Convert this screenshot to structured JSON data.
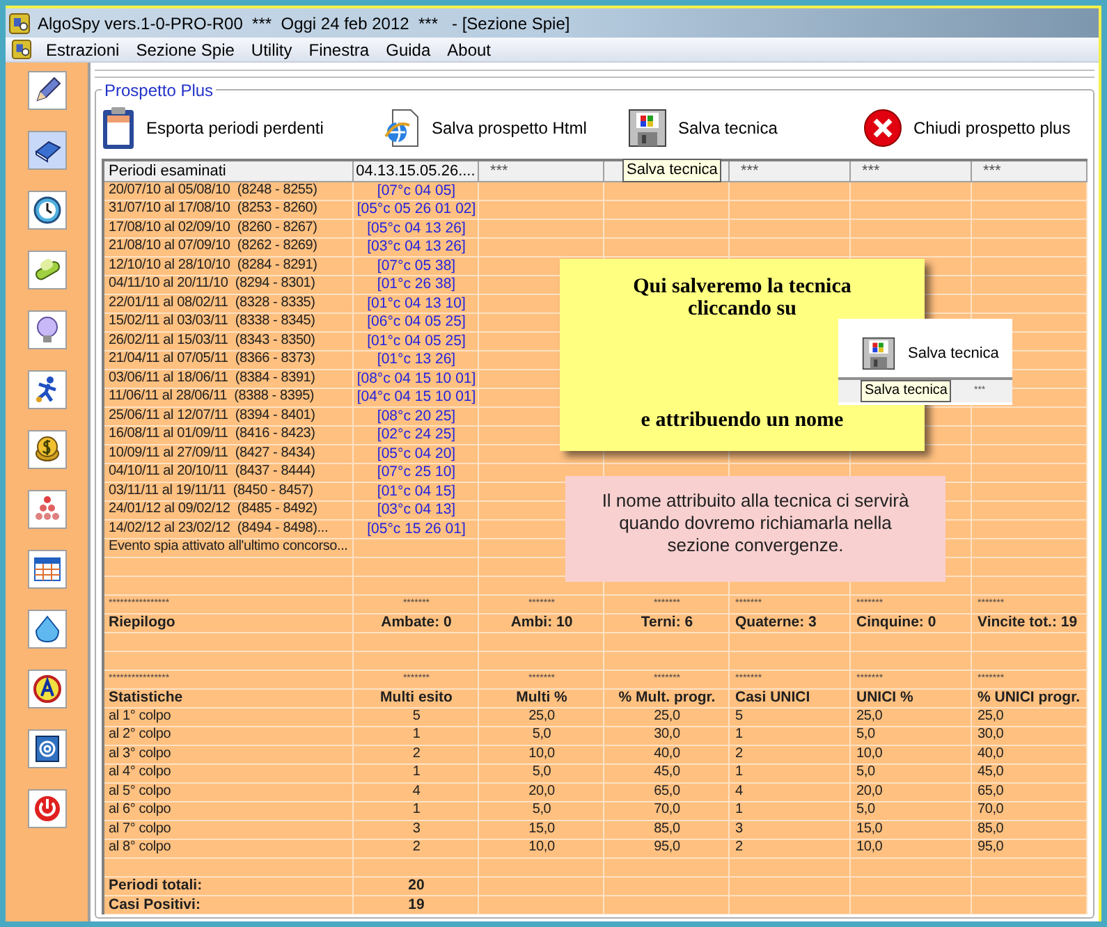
{
  "window": {
    "title": "AlgoSpy vers.1-0-PRO-R00  ***  Oggi 24 feb 2012  ***   - [Sezione Spie]"
  },
  "menu": [
    "Estrazioni",
    "Sezione Spie",
    "Utility",
    "Finestra",
    "Guida",
    "About"
  ],
  "panel": {
    "title": "Prospetto Plus"
  },
  "toolbar": [
    {
      "kind": "export",
      "label": "Esporta periodi perdenti"
    },
    {
      "kind": "html",
      "label": "Salva prospetto Html"
    },
    {
      "kind": "save",
      "label": "Salva tecnica"
    },
    {
      "kind": "close",
      "label": "Chiudi prospetto plus"
    }
  ],
  "tooltip": "Salva tecnica",
  "table": {
    "columns": [
      "Periodi esaminati",
      "04.13.15.05.26....",
      "***",
      "",
      "***",
      "***",
      "***"
    ],
    "rows": [
      {
        "kind": "period",
        "cells": [
          "20/07/10 al 05/08/10  (8248 - 8255)",
          "[07°c 04 05]"
        ]
      },
      {
        "kind": "period",
        "cells": [
          "31/07/10 al 17/08/10  (8253 - 8260)",
          "[05°c 05 26 01 02]"
        ]
      },
      {
        "kind": "period",
        "cells": [
          "17/08/10 al 02/09/10  (8260 - 8267)",
          "[05°c 04 13 26]"
        ]
      },
      {
        "kind": "period",
        "cells": [
          "21/08/10 al 07/09/10  (8262 - 8269)",
          "[03°c 04 13 26]"
        ]
      },
      {
        "kind": "period",
        "cells": [
          "12/10/10 al 28/10/10  (8284 - 8291)",
          "[07°c 05 38]"
        ]
      },
      {
        "kind": "period",
        "cells": [
          "04/11/10 al 20/11/10  (8294 - 8301)",
          "[01°c 26 38]"
        ]
      },
      {
        "kind": "period",
        "cells": [
          "22/01/11 al 08/02/11  (8328 - 8335)",
          "[01°c 04 13 10]"
        ]
      },
      {
        "kind": "period",
        "cells": [
          "15/02/11 al 03/03/11  (8338 - 8345)",
          "[06°c 04 05 25]"
        ]
      },
      {
        "kind": "period",
        "cells": [
          "26/02/11 al 15/03/11  (8343 - 8350)",
          "[01°c 04 05 25]"
        ]
      },
      {
        "kind": "period",
        "cells": [
          "21/04/11 al 07/05/11  (8366 - 8373)",
          "[01°c 13 26]"
        ]
      },
      {
        "kind": "period",
        "cells": [
          "03/06/11 al 18/06/11  (8384 - 8391)",
          "[08°c 04 15 10 01]"
        ]
      },
      {
        "kind": "period",
        "cells": [
          "11/06/11 al 28/06/11  (8388 - 8395)",
          "[04°c 04 15 10 01]"
        ]
      },
      {
        "kind": "period",
        "cells": [
          "25/06/11 al 12/07/11  (8394 - 8401)",
          "[08°c 20 25]"
        ]
      },
      {
        "kind": "period",
        "cells": [
          "16/08/11 al 01/09/11  (8416 - 8423)",
          "[02°c 24 25]"
        ]
      },
      {
        "kind": "period",
        "cells": [
          "10/09/11 al 27/09/11  (8427 - 8434)",
          "[05°c 04 20]"
        ]
      },
      {
        "kind": "period",
        "cells": [
          "04/10/11 al 20/10/11  (8437 - 8444)",
          "[07°c 25 10]"
        ]
      },
      {
        "kind": "period",
        "cells": [
          "03/11/11 al 19/11/11  (8450 - 8457)",
          "[01°c 04 15]"
        ]
      },
      {
        "kind": "period",
        "cells": [
          "24/01/12 al 09/02/12  (8485 - 8492)",
          "[03°c 04 13]"
        ]
      },
      {
        "kind": "period",
        "cells": [
          "14/02/12 al 23/02/12  (8494 - 8498)...",
          "[05°c 15 26 01]"
        ]
      },
      {
        "kind": "plain",
        "cells": [
          "Evento spia attivato all'ultimo concorso..."
        ]
      },
      {
        "kind": "plain",
        "cells": []
      },
      {
        "kind": "plain",
        "cells": []
      },
      {
        "kind": "separator",
        "cells": [
          "****************",
          "*******",
          "*******",
          "*******",
          "*******",
          "*******",
          "*******"
        ]
      },
      {
        "kind": "bold",
        "cells": [
          "Riepilogo",
          "Ambate: 0",
          "Ambi: 10",
          "Terni: 6",
          "Quaterne: 3",
          "Cinquine: 0",
          "Vincite tot.: 19"
        ]
      },
      {
        "kind": "plain",
        "cells": []
      },
      {
        "kind": "plain",
        "cells": []
      },
      {
        "kind": "separator",
        "cells": [
          "****************",
          "*******",
          "*******",
          "*******",
          "*******",
          "*******",
          "*******"
        ]
      },
      {
        "kind": "bold",
        "cells": [
          "Statistiche",
          "Multi esito",
          "Multi %",
          "% Mult. progr.",
          "Casi UNICI",
          "UNICI %",
          "% UNICI progr."
        ]
      },
      {
        "kind": "plain",
        "cells": [
          "al 1° colpo",
          "5",
          "25,0",
          "25,0",
          "5",
          "25,0",
          "25,0"
        ]
      },
      {
        "kind": "plain",
        "cells": [
          "al 2° colpo",
          "1",
          "5,0",
          "30,0",
          "1",
          "5,0",
          "30,0"
        ]
      },
      {
        "kind": "plain",
        "cells": [
          "al 3° colpo",
          "2",
          "10,0",
          "40,0",
          "2",
          "10,0",
          "40,0"
        ]
      },
      {
        "kind": "plain",
        "cells": [
          "al 4° colpo",
          "1",
          "5,0",
          "45,0",
          "1",
          "5,0",
          "45,0"
        ]
      },
      {
        "kind": "plain",
        "cells": [
          "al 5° colpo",
          "4",
          "20,0",
          "65,0",
          "4",
          "20,0",
          "65,0"
        ]
      },
      {
        "kind": "plain",
        "cells": [
          "al 6° colpo",
          "1",
          "5,0",
          "70,0",
          "1",
          "5,0",
          "70,0"
        ]
      },
      {
        "kind": "plain",
        "cells": [
          "al 7° colpo",
          "3",
          "15,0",
          "85,0",
          "3",
          "15,0",
          "85,0"
        ]
      },
      {
        "kind": "plain",
        "cells": [
          "al 8° colpo",
          "2",
          "10,0",
          "95,0",
          "2",
          "10,0",
          "95,0"
        ]
      },
      {
        "kind": "plain",
        "cells": []
      },
      {
        "kind": "bold",
        "cells": [
          "Periodi totali:",
          "20"
        ]
      },
      {
        "kind": "bold",
        "cells": [
          "Casi Positivi:",
          "19"
        ]
      }
    ]
  },
  "callout": {
    "line_1": "Qui salveremo la tecnica",
    "line_2": "cliccando su",
    "inset": {
      "button": "Salva tecnica",
      "tooltip": "Salva tecnica",
      "column": "***"
    },
    "line_3": "e attribuendo un nome"
  },
  "info_note": {
    "text": "Il nome attribuito alla tecnica ci servirà quando dovremo richiamarla nella sezione convergenze."
  }
}
